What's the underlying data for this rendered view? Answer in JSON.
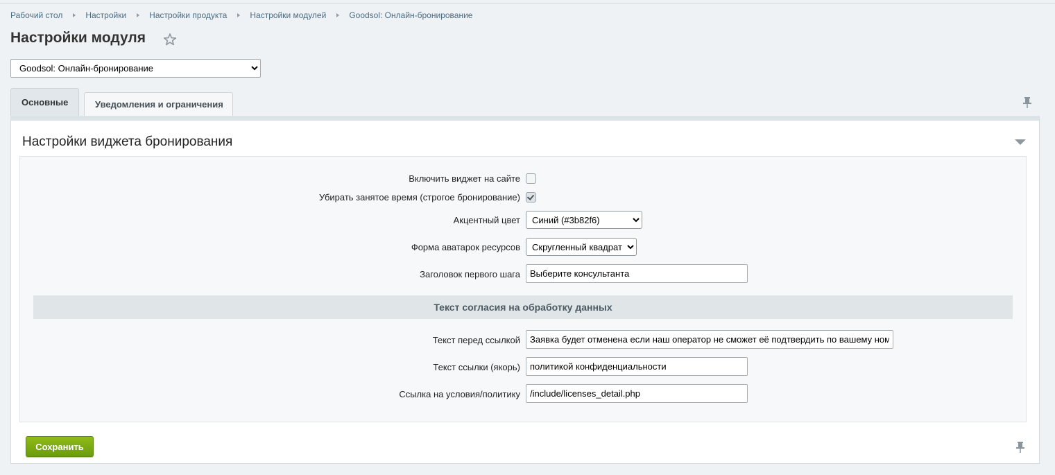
{
  "breadcrumb": [
    "Рабочий стол",
    "Настройки",
    "Настройки продукта",
    "Настройки модулей",
    "Goodsol: Онлайн-бронирование"
  ],
  "page_title": "Настройки модуля",
  "icons": {
    "favorite": "star-icon",
    "pin": "pin-icon",
    "collapse": "chevron-down-icon"
  },
  "module_select": {
    "value": "Goodsol: Онлайн-бронирование"
  },
  "tabs": [
    {
      "label": "Основные",
      "active": true
    },
    {
      "label": "Уведомления и ограничения",
      "active": false
    }
  ],
  "section": {
    "title": "Настройки виджета бронирования"
  },
  "fields": {
    "enable_widget": {
      "label": "Включить виджет на сайте",
      "checked": false
    },
    "strict_booking": {
      "label": "Убирать занятое время (строгое бронирование)",
      "checked": true
    },
    "accent_color": {
      "label": "Акцентный цвет",
      "value": "Синий (#3b82f6)"
    },
    "avatar_shape": {
      "label": "Форма аватарок ресурсов",
      "value": "Скругленный квадрат"
    },
    "first_step_title": {
      "label": "Заголовок первого шага",
      "value": "Выберите консультанта"
    }
  },
  "consent": {
    "header": "Текст согласия на обработку данных",
    "text_before": {
      "label": "Текст перед ссылкой",
      "value": "Заявка будет отменена если наш оператор не сможет её подтвердить по вашему номеру телефона"
    },
    "link_text": {
      "label": "Текст ссылки (якорь)",
      "value": "политикой конфиденциальности"
    },
    "policy_url": {
      "label": "Ссылка на условия/политику",
      "value": "/include/licenses_detail.php"
    }
  },
  "buttons": {
    "save": "Сохранить"
  },
  "colors": {
    "save_button": "#7aab12",
    "breadcrumb_link": "#4a6b82",
    "page_background": "#eef2f4"
  }
}
